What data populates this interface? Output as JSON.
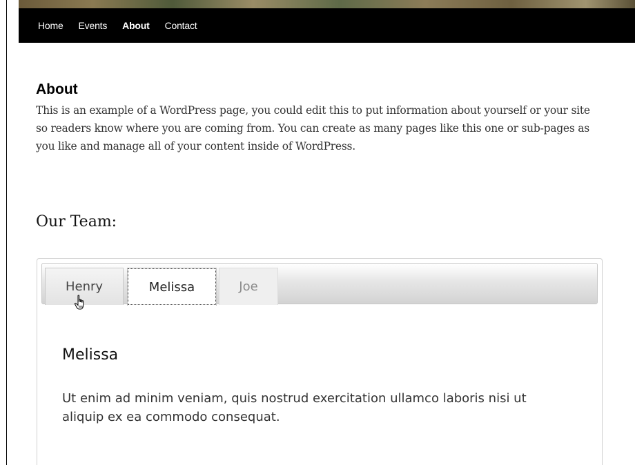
{
  "nav": {
    "items": [
      {
        "label": "Home"
      },
      {
        "label": "Events"
      },
      {
        "label": "About"
      },
      {
        "label": "Contact"
      }
    ],
    "active": "About"
  },
  "page": {
    "title": "About",
    "intro": "This is an example of a WordPress page, you could edit this to put information about yourself or your site so readers know where you are coming from. You can create as many pages like this one or sub-pages as you like and manage all of your content inside of WordPress."
  },
  "team": {
    "heading": "Our Team:",
    "tabs": [
      {
        "label": "Henry"
      },
      {
        "label": "Melissa"
      },
      {
        "label": "Joe"
      }
    ],
    "selected": "Melissa",
    "panel": {
      "title": "Melissa",
      "text": "Ut enim ad minim veniam, quis nostrud exercitation ullamco laboris nisi ut aliquip ex ea commodo consequat."
    }
  },
  "icons": {
    "cursor": "hand-pointer-icon"
  }
}
